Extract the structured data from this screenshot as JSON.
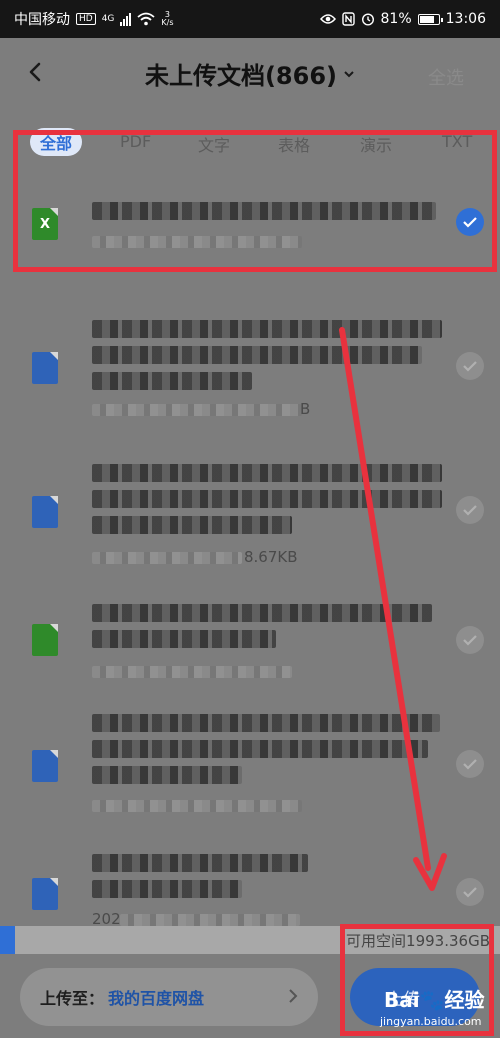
{
  "status_bar": {
    "carrier": "中国移动",
    "hd": "HD",
    "network": "4G",
    "speed_value": "3",
    "speed_unit": "K/s",
    "battery": "81%",
    "battery_level": 0.81,
    "time": "13:06"
  },
  "header": {
    "title": "未上传文档(866)",
    "select_all": "全选"
  },
  "tabs": [
    {
      "label": "全部",
      "active": true
    },
    {
      "label": "PDF"
    },
    {
      "label": "文字"
    },
    {
      "label": "表格"
    },
    {
      "label": "演示"
    },
    {
      "label": "TXT"
    }
  ],
  "files": [
    {
      "type": "sheet",
      "icon_glyph": "X",
      "checked": true,
      "meta_suffix": ""
    },
    {
      "type": "doc",
      "icon_glyph": "",
      "checked": false,
      "meta_suffix": "B"
    },
    {
      "type": "doc",
      "icon_glyph": "",
      "checked": false,
      "meta_suffix": "8.67KB"
    },
    {
      "type": "sheet",
      "icon_glyph": "",
      "checked": false,
      "meta_suffix": ""
    },
    {
      "type": "doc",
      "icon_glyph": "",
      "checked": false,
      "meta_suffix": ""
    },
    {
      "type": "doc",
      "icon_glyph": "",
      "checked": false,
      "meta_prefix": "202"
    }
  ],
  "storage": {
    "available_text": "可用空间1993.36GB",
    "used_fraction": 0.03
  },
  "bottom": {
    "dest_label": "上传至：",
    "dest_value": "我的百度网盘",
    "upload_label": "上传"
  },
  "watermark": {
    "logo": "Bai🐾经验",
    "url": "jingyan.baidu.com"
  },
  "colors": {
    "accent": "#2f6fd6",
    "annotation": "#e8323e",
    "sheet_icon": "#2f8a2a",
    "doc_icon": "#2f63b8"
  }
}
